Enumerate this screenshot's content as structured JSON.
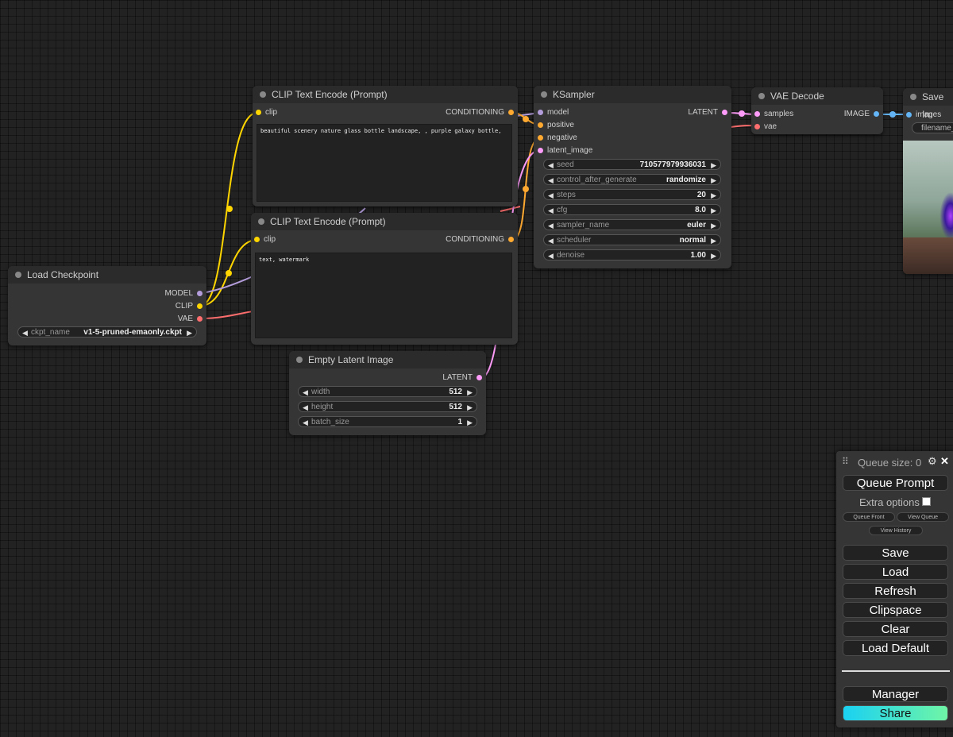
{
  "nodes": {
    "load_checkpoint": {
      "title": "Load Checkpoint",
      "outputs": [
        "MODEL",
        "CLIP",
        "VAE"
      ],
      "widget": {
        "label": "ckpt_name",
        "value": "v1-5-pruned-emaonly.ckpt"
      }
    },
    "clip_positive": {
      "title": "CLIP Text Encode (Prompt)",
      "input": "clip",
      "output": "CONDITIONING",
      "text": "beautiful scenery nature glass bottle landscape, , purple galaxy bottle,"
    },
    "clip_negative": {
      "title": "CLIP Text Encode (Prompt)",
      "input": "clip",
      "output": "CONDITIONING",
      "text": "text, watermark"
    },
    "empty_latent": {
      "title": "Empty Latent Image",
      "output": "LATENT",
      "widgets": [
        {
          "label": "width",
          "value": "512"
        },
        {
          "label": "height",
          "value": "512"
        },
        {
          "label": "batch_size",
          "value": "1"
        }
      ]
    },
    "ksampler": {
      "title": "KSampler",
      "inputs": [
        "model",
        "positive",
        "negative",
        "latent_image"
      ],
      "output": "LATENT",
      "widgets": [
        {
          "label": "seed",
          "value": "710577979936031"
        },
        {
          "label": "control_after_generate",
          "value": "randomize"
        },
        {
          "label": "steps",
          "value": "20"
        },
        {
          "label": "cfg",
          "value": "8.0"
        },
        {
          "label": "sampler_name",
          "value": "euler"
        },
        {
          "label": "scheduler",
          "value": "normal"
        },
        {
          "label": "denoise",
          "value": "1.00"
        }
      ]
    },
    "vae_decode": {
      "title": "VAE Decode",
      "inputs": [
        "samples",
        "vae"
      ],
      "output": "IMAGE"
    },
    "save_image": {
      "title": "Save Im",
      "input": "images",
      "widget_label": "filename_"
    }
  },
  "menu": {
    "queue_size_label": "Queue size: 0",
    "queue_prompt": "Queue Prompt",
    "extra_options": "Extra options",
    "queue_front": "Queue Front",
    "view_queue": "View Queue",
    "view_history": "View History",
    "save": "Save",
    "load": "Load",
    "refresh": "Refresh",
    "clipspace": "Clipspace",
    "clear": "Clear",
    "load_default": "Load Default",
    "manager": "Manager",
    "share": "Share"
  },
  "colors": {
    "model": "#b39ddb",
    "clip": "#ffd500",
    "vae": "#ff6e6e",
    "conditioning": "#ffa931",
    "latent": "#ff9cf9",
    "image": "#64b5f6"
  }
}
